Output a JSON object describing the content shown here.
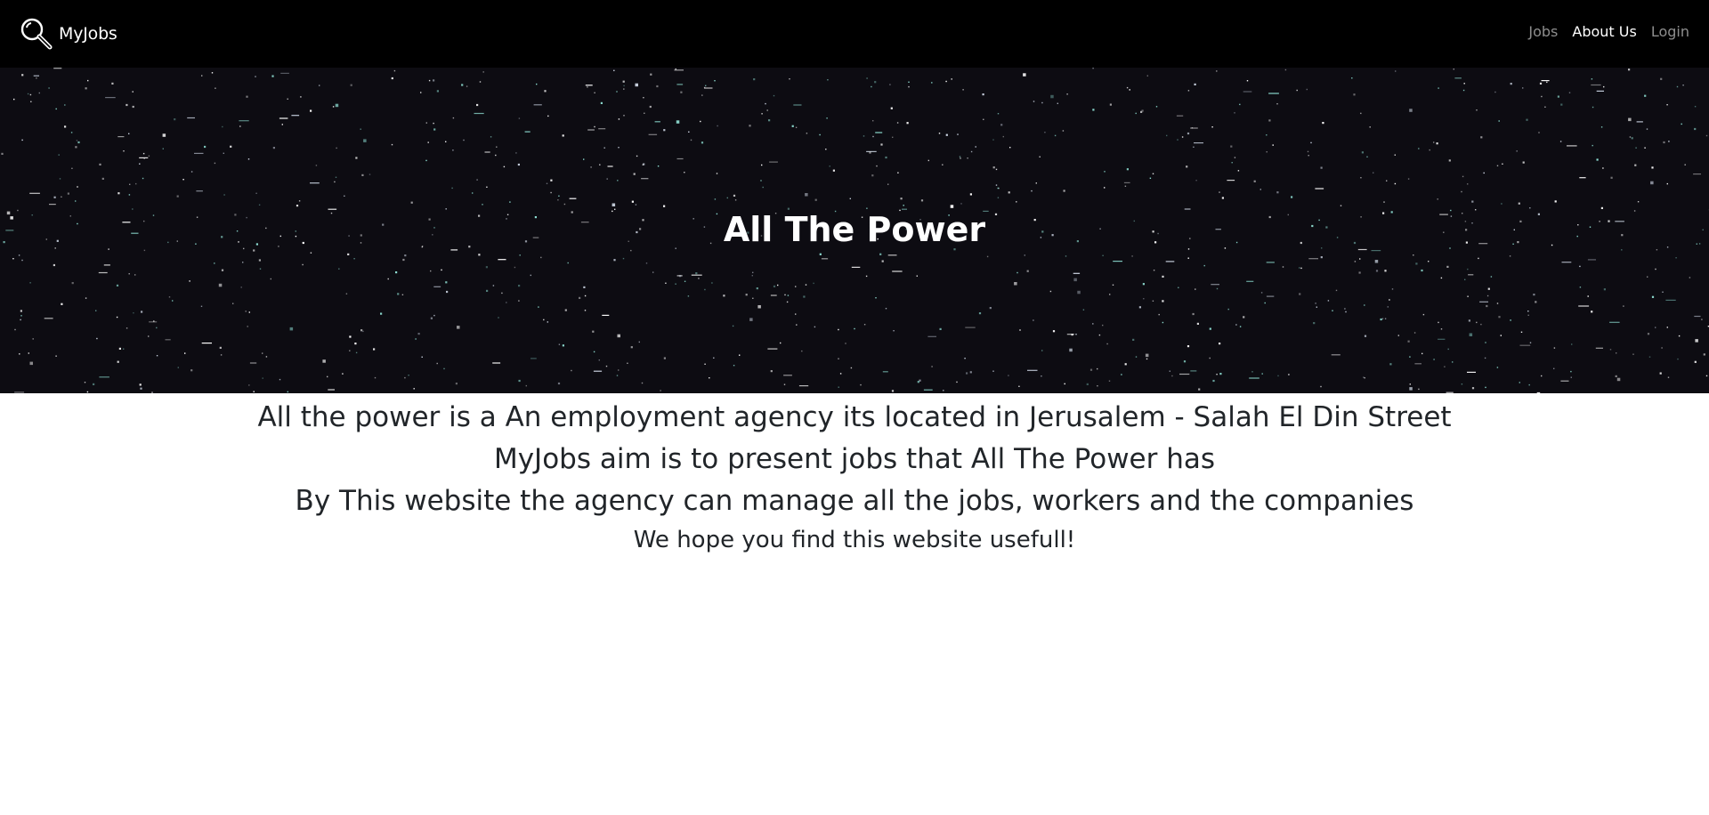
{
  "navbar": {
    "brand": "MyJobs",
    "brand_icon": "magnifier-icon",
    "links": [
      {
        "label": "Jobs",
        "active": false
      },
      {
        "label": "About Us",
        "active": true
      },
      {
        "label": "Login",
        "active": false
      }
    ]
  },
  "hero": {
    "title": "All The Power",
    "background_color": "#0d0c12"
  },
  "about": {
    "lines": [
      "All the power is a An employment agency its located in Jerusalem - Salah El Din Street",
      "MyJobs aim is to present jobs that All The Power has",
      "By This website the agency can manage all the jobs, workers and the companies"
    ],
    "closing": "We hope you find this website usefull!"
  },
  "colors": {
    "navbar_bg": "#000000",
    "text_dark": "#212529",
    "nav_inactive": "rgba(255,255,255,0.55)",
    "nav_active": "#ffffff"
  }
}
